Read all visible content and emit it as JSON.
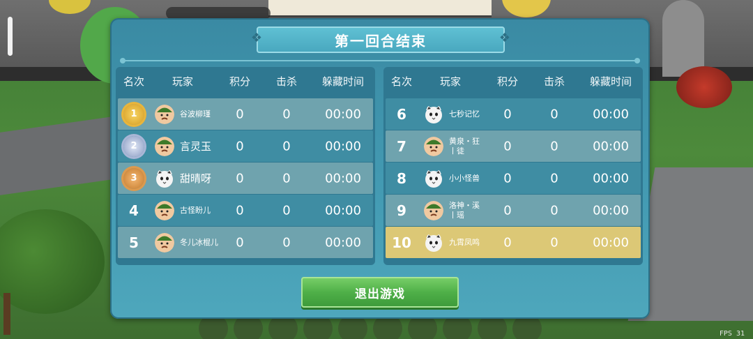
{
  "dialog": {
    "title": "第一回合结束",
    "exit_button": "退出游戏"
  },
  "columns": [
    "名次",
    "玩家",
    "积分",
    "击杀",
    "躲藏时间"
  ],
  "left_table": [
    {
      "rank": "1",
      "medal": "gold",
      "avatar": "hunter-icon",
      "name": "谷波柳瑾",
      "score": "0",
      "kills": "0",
      "hide_time": "00:00"
    },
    {
      "rank": "2",
      "medal": "silver",
      "avatar": "hunter-icon",
      "name": "言灵玉",
      "score": "0",
      "kills": "0",
      "hide_time": "00:00"
    },
    {
      "rank": "3",
      "medal": "bronze",
      "avatar": "cat-icon",
      "name": "甜晴呀",
      "score": "0",
      "kills": "0",
      "hide_time": "00:00"
    },
    {
      "rank": "4",
      "medal": "",
      "avatar": "hunter-icon",
      "name": "古怪盼儿",
      "score": "0",
      "kills": "0",
      "hide_time": "00:00"
    },
    {
      "rank": "5",
      "medal": "",
      "avatar": "hunter-icon",
      "name": "冬儿冰棍儿",
      "score": "0",
      "kills": "0",
      "hide_time": "00:00"
    }
  ],
  "right_table": [
    {
      "rank": "6",
      "avatar": "cat-icon",
      "name": "七秒记忆",
      "score": "0",
      "kills": "0",
      "hide_time": "00:00"
    },
    {
      "rank": "7",
      "avatar": "hunter-icon",
      "name": "黄泉・狂丨徒",
      "score": "0",
      "kills": "0",
      "hide_time": "00:00"
    },
    {
      "rank": "8",
      "avatar": "cat-icon",
      "name": "小小怪兽",
      "score": "0",
      "kills": "0",
      "hide_time": "00:00"
    },
    {
      "rank": "9",
      "avatar": "hunter-icon",
      "name": "洛神・溪丨瑶",
      "score": "0",
      "kills": "0",
      "hide_time": "00:00"
    },
    {
      "rank": "10",
      "avatar": "cat-icon",
      "name": "九霄凤鸣",
      "score": "0",
      "kills": "0",
      "hide_time": "00:00",
      "is_self": true
    }
  ],
  "hud": {
    "fps": "FPS 31"
  },
  "colors": {
    "dialog_bg": "#3a8aa3",
    "row_light": "#6fa3ae",
    "row_dark": "#3f8da3",
    "self_row": "#dcc876",
    "exit_button": "#4fb048"
  }
}
